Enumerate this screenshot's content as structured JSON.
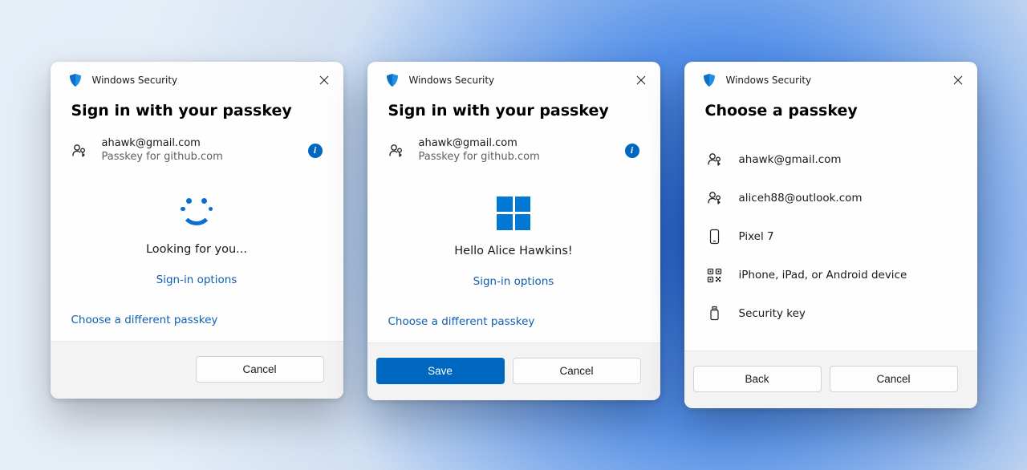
{
  "window_title": "Windows Security",
  "dialog1": {
    "heading": "Sign in with your passkey",
    "email": "ahawk@gmail.com",
    "subtext": "Passkey for github.com",
    "status": "Looking for you...",
    "signin_options": "Sign-in options",
    "choose_different": "Choose a different passkey",
    "cancel": "Cancel"
  },
  "dialog2": {
    "heading": "Sign in with your passkey",
    "email": "ahawk@gmail.com",
    "subtext": "Passkey for github.com",
    "greeting": "Hello Alice Hawkins!",
    "signin_options": "Sign-in options",
    "choose_different": "Choose a different passkey",
    "save": "Save",
    "cancel": "Cancel"
  },
  "dialog3": {
    "heading": "Choose a passkey",
    "items": [
      "ahawk@gmail.com",
      "aliceh88@outlook.com",
      "Pixel 7",
      "iPhone, iPad, or Android device",
      "Security key"
    ],
    "back": "Back",
    "cancel": "Cancel"
  }
}
